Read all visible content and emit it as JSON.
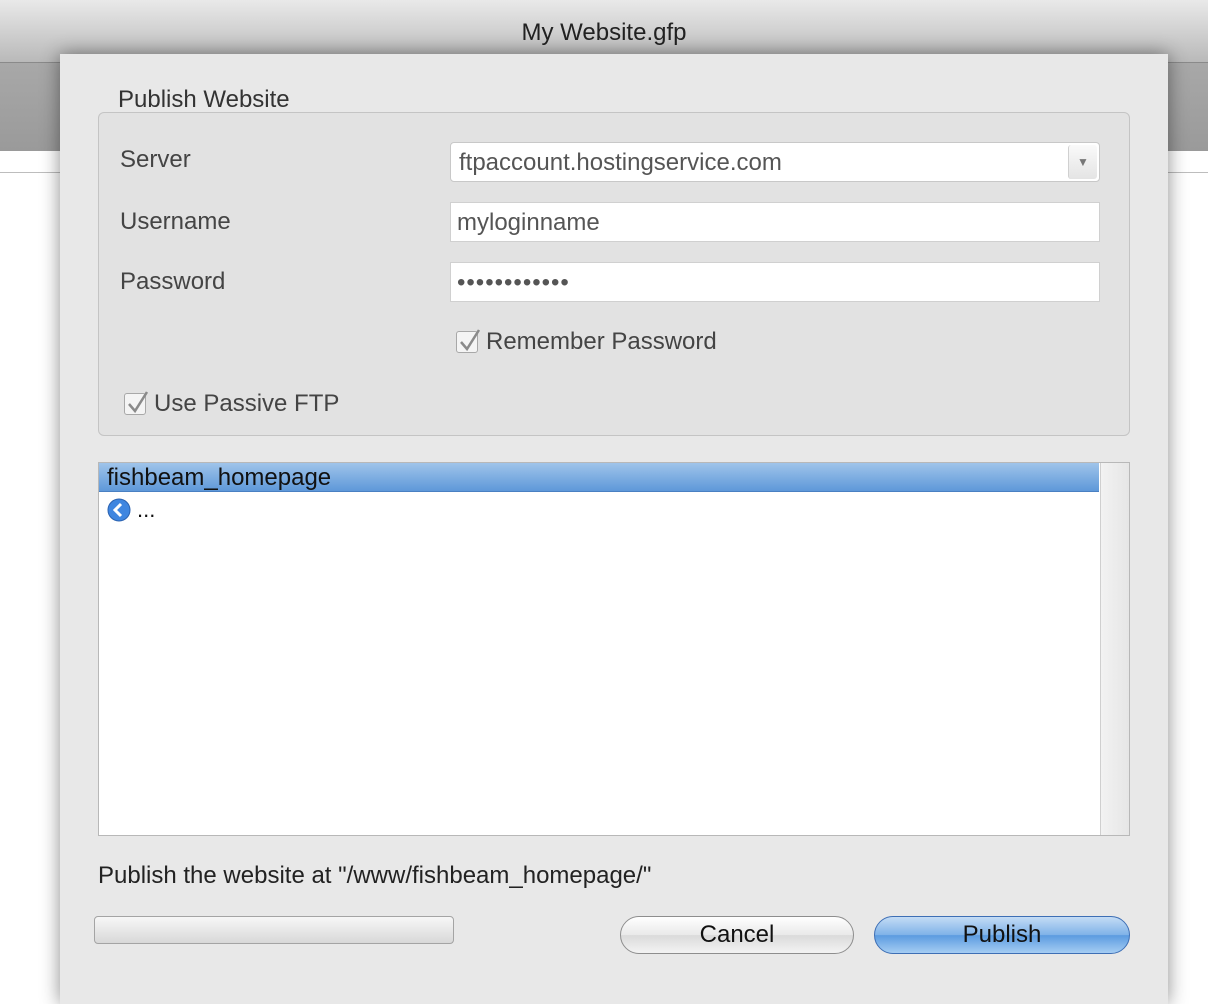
{
  "window": {
    "title": "My Website.gfp"
  },
  "sheet": {
    "group_title": "Publish Website",
    "server": {
      "label": "Server",
      "value": "ftpaccount.hostingservice.com"
    },
    "username": {
      "label": "Username",
      "value": "myloginname"
    },
    "password": {
      "label": "Password",
      "value": "••••••••••••"
    },
    "remember_password": {
      "label": "Remember Password",
      "checked": true
    },
    "passive_ftp": {
      "label": "Use Passive FTP",
      "checked": true
    },
    "browser": {
      "header": "fishbeam_homepage",
      "items": [
        {
          "icon": "back-arrow-icon",
          "label": "..."
        }
      ]
    },
    "status_text": "Publish the website at \"/www/fishbeam_homepage/\"",
    "progress": 0,
    "buttons": {
      "cancel": "Cancel",
      "publish": "Publish"
    }
  },
  "colors": {
    "accent": "#5e98d9",
    "sheet_bg": "#e8e8e8"
  }
}
